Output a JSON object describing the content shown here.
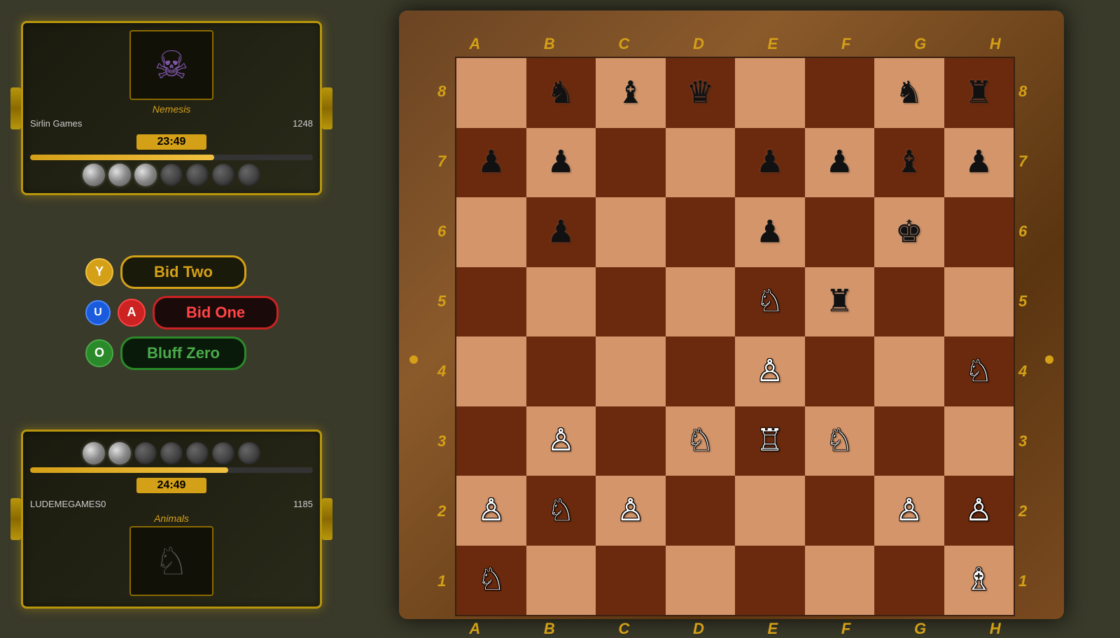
{
  "players": {
    "top": {
      "name": "Sirlin Games",
      "rating": "1248",
      "timer": "23:49",
      "timer_pct": 65,
      "title": "Nemesis",
      "gems_filled": 3,
      "gems_empty": 4
    },
    "bottom": {
      "name": "LUDEMEGAMES0",
      "rating": "1185",
      "timer": "24:49",
      "timer_pct": 70,
      "title": "Animals",
      "gems_filled": 2,
      "gems_empty": 5
    }
  },
  "actions": {
    "bid_two": {
      "icon": "Y",
      "label": "Bid Two"
    },
    "bid_one": {
      "icon": "A",
      "label": "Bid One"
    },
    "bluff_zero": {
      "icon": "O",
      "label": "Bluff Zero"
    },
    "u_icon": "U"
  },
  "board": {
    "coords_top": [
      "A",
      "B",
      "C",
      "D",
      "E",
      "F",
      "G",
      "H"
    ],
    "coords_bottom": [
      "A",
      "B",
      "C",
      "D",
      "E",
      "F",
      "G",
      "H"
    ],
    "coords_left": [
      "8",
      "7",
      "6",
      "5",
      "4",
      "3",
      "2",
      "1"
    ],
    "coords_right": [
      "8",
      "7",
      "6",
      "5",
      "4",
      "3",
      "2",
      "1"
    ]
  }
}
